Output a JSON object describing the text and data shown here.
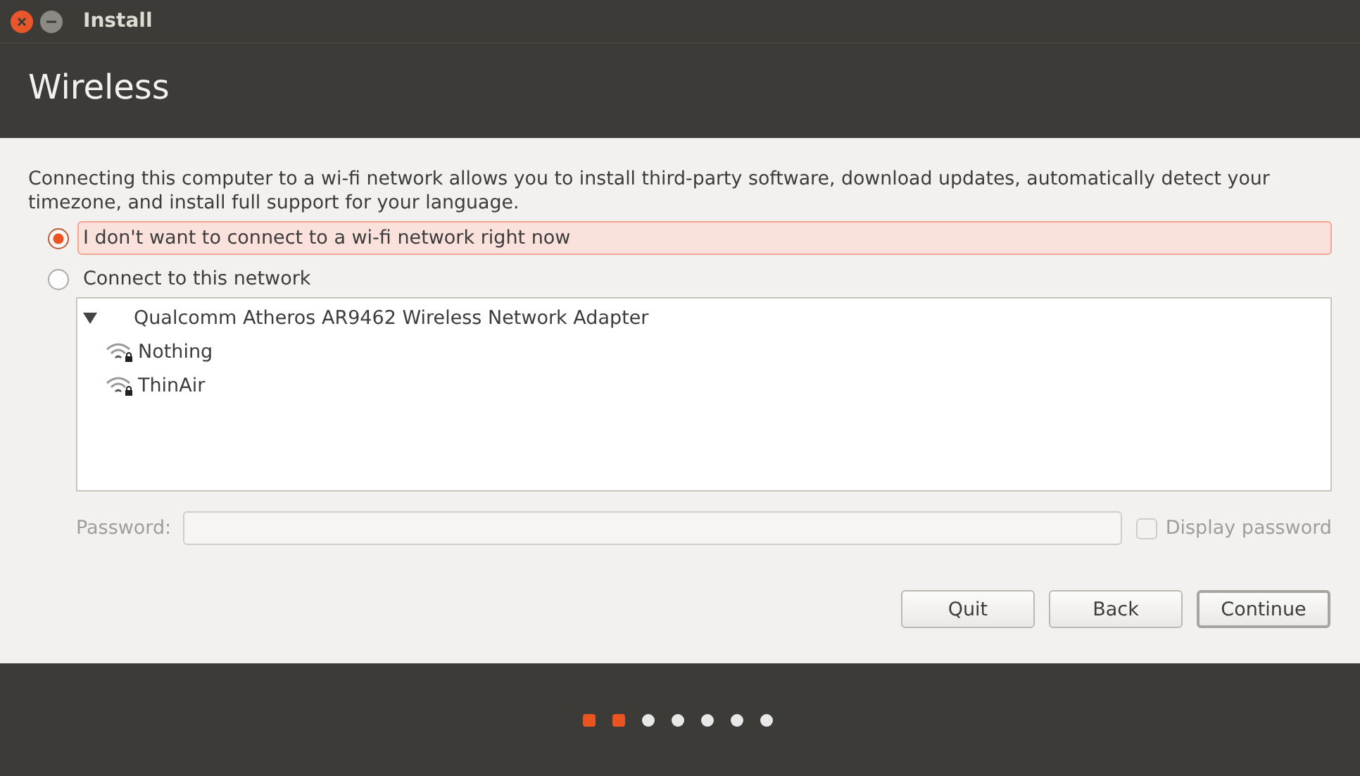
{
  "window": {
    "title": "Install"
  },
  "page_title": "Wireless",
  "intro": "Connecting this computer to a wi-fi network allows you to install third-party software, download updates, automatically detect your timezone, and install full support for your language.",
  "options": [
    {
      "label": "I don't want to connect to a wi-fi network right now",
      "selected": true
    },
    {
      "label": "Connect to this network",
      "selected": false
    }
  ],
  "network_tree": {
    "adapter": {
      "label": "Qualcomm Atheros AR9462 Wireless Network Adapter",
      "expanded": true,
      "children": [
        {
          "label": "Nothing",
          "secured": true
        },
        {
          "label": "ThinAir",
          "secured": true
        }
      ]
    }
  },
  "password": {
    "label": "Password:",
    "disabled": true,
    "display_password": {
      "label": "Display password",
      "checked": false
    }
  },
  "buttons": [
    {
      "label": "Quit",
      "default": false
    },
    {
      "label": "Back",
      "default": false
    },
    {
      "label": "Continue",
      "default": true
    }
  ],
  "progress": [
    {
      "done": true
    },
    {
      "done": true
    },
    {
      "done": false
    },
    {
      "done": false
    },
    {
      "done": false
    },
    {
      "done": false
    },
    {
      "done": false
    }
  ]
}
